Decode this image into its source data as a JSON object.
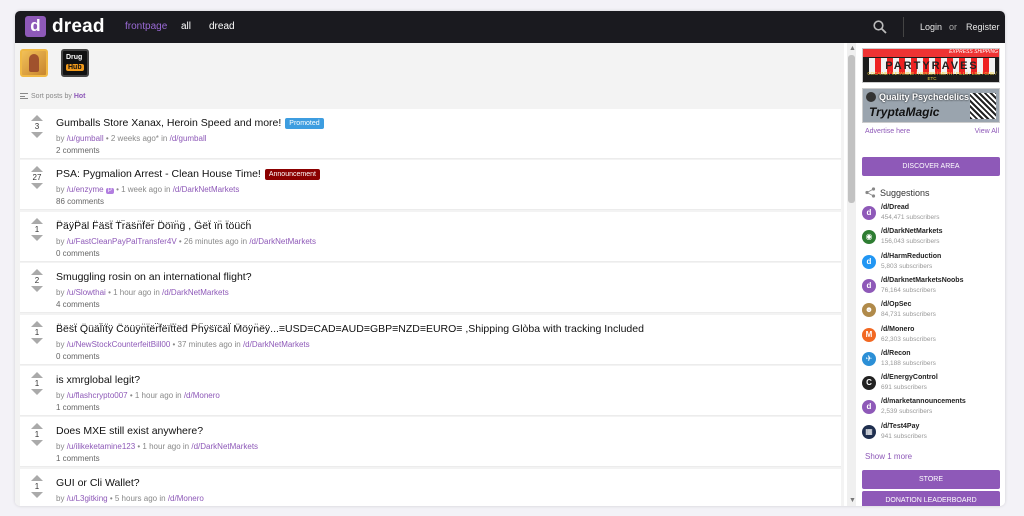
{
  "colors": {
    "accent": "#8e59b8",
    "topbar": "#1a1a1f",
    "promoted": "#3d9de0",
    "announcement": "#8b0000"
  },
  "header": {
    "logo_letter": "d",
    "logo_text": "dread",
    "nav": [
      "frontpage",
      "all",
      "dread"
    ],
    "login": "Login",
    "or": "or",
    "register": "Register"
  },
  "stickies": {
    "second_line1": "Drug",
    "second_line2": "Hub"
  },
  "sort": {
    "label": "Sort posts by",
    "value": "Hot"
  },
  "posts": [
    {
      "score": "3",
      "title": "Gumballs Store Xanax, Heroin Speed and more!",
      "badge": "Promoted",
      "badge_color": "#3d9de0",
      "by": "by",
      "user": "/u/gumball",
      "mod": "",
      "time": "• 2 weeks ago* in",
      "sub": "/d/gumball",
      "comments": "2 comments"
    },
    {
      "score": "27",
      "title": "PSA: Pygmalion Arrest - Clean House Time!",
      "badge": "Announcement",
      "badge_color": "#8b0000",
      "by": "by",
      "user": "/u/enzyme",
      "mod": "P",
      "time": "• 1 week ago in",
      "sub": "/d/DarkNetMarkets",
      "comments": "86 comments"
    },
    {
      "score": "1",
      "title": "P̈äÿP̈äl F̈äs̈ẗ T̈r̈äs̈n̈f̈ër̈ D̈öïn̈g̈ , G̈ëẗ ïn̈ ẗöüc̈ḧ",
      "badge": "",
      "badge_color": "",
      "by": "by",
      "user": "/u/FastCleanPayPalTransfer4V",
      "mod": "",
      "time": "• 26 minutes ago in",
      "sub": "/d/DarkNetMarkets",
      "comments": "0 comments"
    },
    {
      "score": "2",
      "title": "Smuggling rosin on an international flight?",
      "badge": "",
      "badge_color": "",
      "by": "by",
      "user": "/u/Slowthai",
      "mod": "",
      "time": "• 1 hour ago in",
      "sub": "/d/DarkNetMarkets",
      "comments": "4 comments"
    },
    {
      "score": "1",
      "title": "B̈ës̈ẗ Q̈üäl̈ïẗÿ C̈öüÿn̈ẗër̈f̈ëïẗẗëd̈ P̈ḧÿs̈ïc̈äl̈ M̈öÿn̈ëÿ...≡USD≡CAD≡AUD≡GBP≡NZD≡EURO≡ ,Shipping Glòba with tracking Included",
      "badge": "",
      "badge_color": "",
      "by": "by",
      "user": "/u/NewStockCounterfeitBill00",
      "mod": "",
      "time": "• 37 minutes ago in",
      "sub": "/d/DarkNetMarkets",
      "comments": "0 comments"
    },
    {
      "score": "1",
      "title": "is xmrglobal legit?",
      "badge": "",
      "badge_color": "",
      "by": "by",
      "user": "/u/flashcrypto007",
      "mod": "",
      "time": "• 1 hour ago in",
      "sub": "/d/Monero",
      "comments": "1 comments"
    },
    {
      "score": "1",
      "title": "Does MXE still exist anywhere?",
      "badge": "",
      "badge_color": "",
      "by": "by",
      "user": "/u/ilikeketamine123",
      "mod": "",
      "time": "• 1 hour ago in",
      "sub": "/d/DarkNetMarkets",
      "comments": "1 comments"
    },
    {
      "score": "1",
      "title": "GUI or Cli Wallet?",
      "badge": "",
      "badge_color": "",
      "by": "by",
      "user": "/u/L3gitking",
      "mod": "",
      "time": "• 5 hours ago in",
      "sub": "/d/Monero",
      "comments": "1 comments"
    }
  ],
  "sidebar": {
    "ad1": {
      "ship": "EXPRESS SHIPPING",
      "premium": "PREMIUM SUPPLIES",
      "name": "PARTYRAVES",
      "items": "COCAINE / KETAMINE / HEROIN / METH / PILLS / LSD / GHB / ETC"
    },
    "ad2": {
      "line1": "Quality Psychedelics",
      "line2": "TryptaMagic"
    },
    "advertise": "Advertise here",
    "view_all": "View All",
    "discover": "DISCOVER AREA",
    "suggestions_title": "Suggestions",
    "suggestions": [
      {
        "name": "/d/Dread",
        "subs": "454,471 subscribers",
        "color": "#8e59b8",
        "glyph": "d"
      },
      {
        "name": "/d/DarkNetMarkets",
        "subs": "156,043 subscribers",
        "color": "#2e7d32",
        "glyph": "◉"
      },
      {
        "name": "/d/HarmReduction",
        "subs": "5,803 subscribers",
        "color": "#2196f3",
        "glyph": "d"
      },
      {
        "name": "/d/DarknetMarketsNoobs",
        "subs": "76,164 subscribers",
        "color": "#8e59b8",
        "glyph": "d"
      },
      {
        "name": "/d/OpSec",
        "subs": "84,731 subscribers",
        "color": "#b08a4a",
        "glyph": "☻"
      },
      {
        "name": "/d/Monero",
        "subs": "62,303 subscribers",
        "color": "#f26822",
        "glyph": "M"
      },
      {
        "name": "/d/Recon",
        "subs": "13,188 subscribers",
        "color": "#2b8fd6",
        "glyph": "✈"
      },
      {
        "name": "/d/EnergyControl",
        "subs": "691 subscribers",
        "color": "#222222",
        "glyph": "C"
      },
      {
        "name": "/d/marketannouncements",
        "subs": "2,539 subscribers",
        "color": "#8e59b8",
        "glyph": "d"
      },
      {
        "name": "/d/Test4Pay",
        "subs": "941 subscribers",
        "color": "#1f2f4f",
        "glyph": "▦"
      }
    ],
    "show_more": "Show 1 more",
    "store": "STORE",
    "donation": "DONATION LEADERBOARD"
  }
}
